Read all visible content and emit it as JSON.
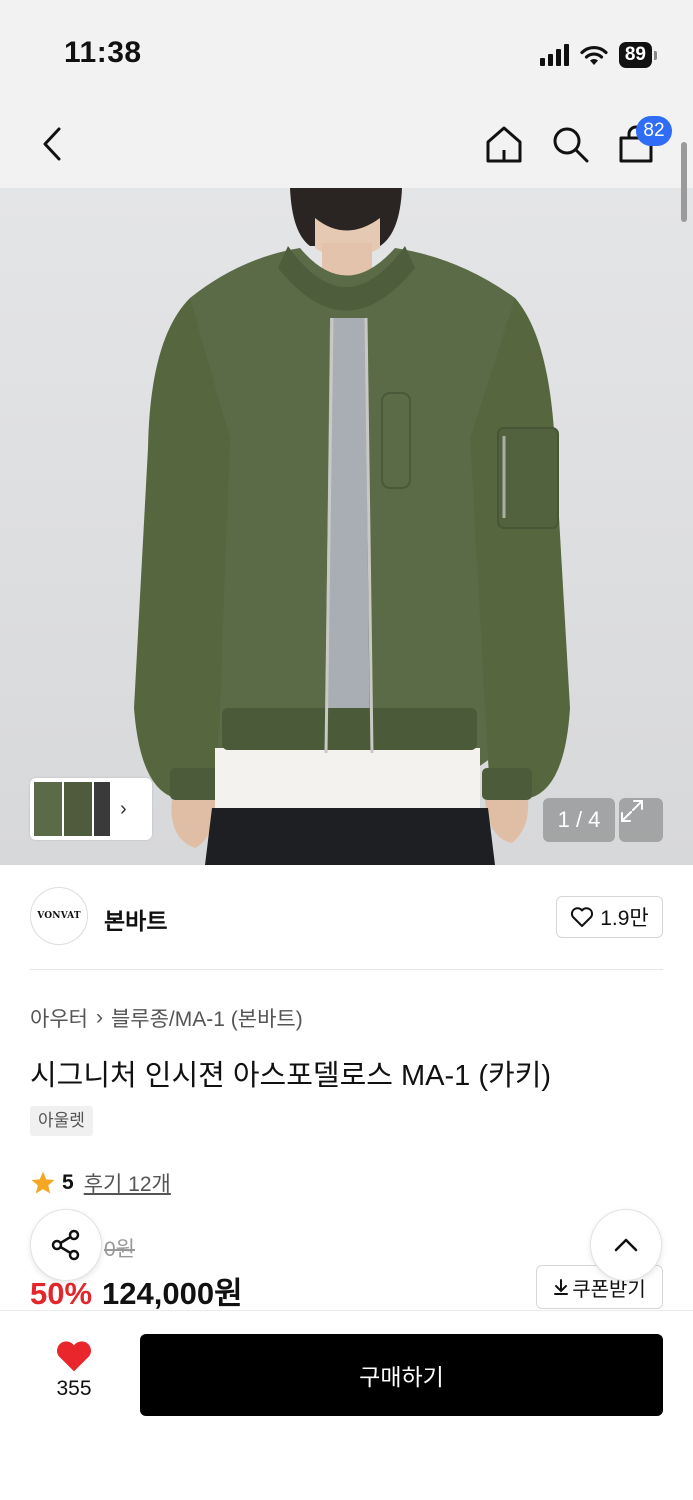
{
  "status_bar": {
    "time": "11:38",
    "battery": "89"
  },
  "nav": {
    "cart_count": "82"
  },
  "gallery": {
    "counter": "1 / 4"
  },
  "brand": {
    "logo_text": "VONVAT",
    "name": "본바트",
    "likes": "1.9만"
  },
  "breadcrumb": {
    "category": "아우터",
    "subcategory": "블루종/MA-1 (본바트)"
  },
  "product": {
    "title": "시그니처 인시젼 아스포델로스 MA-1 (카키)",
    "tag": "아울렛",
    "rating": "5",
    "reviews": "후기 12개",
    "original_price": "0원",
    "discount": "50%",
    "price": "124,000원"
  },
  "coupon": {
    "label": "쿠폰받기"
  },
  "bottom": {
    "like_count": "355",
    "buy_label": "구매하기"
  },
  "colors": {
    "accent_blue": "#2f6df6",
    "discount_red": "#e3262b",
    "heart_red": "#e8262c",
    "star": "#f5a623",
    "jacket_green": "#5b6b47"
  },
  "icons": [
    "back-icon",
    "home-icon",
    "search-icon",
    "cart-icon",
    "expand-icon",
    "heart-outline-icon",
    "star-icon",
    "share-icon",
    "chevron-up-icon",
    "download-icon",
    "heart-filled-icon"
  ]
}
